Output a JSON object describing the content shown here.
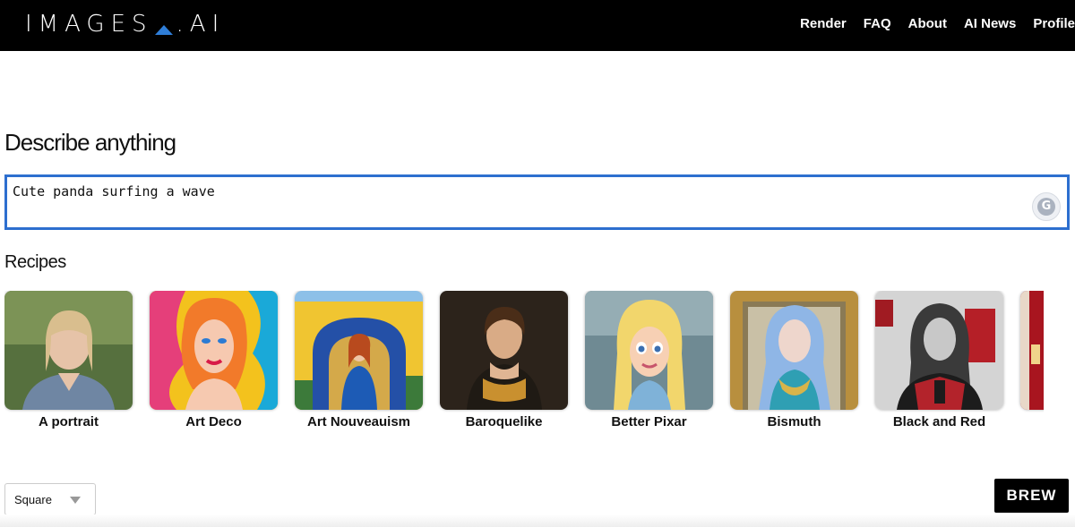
{
  "header": {
    "logo_left": "IMAGES",
    "logo_right": ".AI",
    "nav": [
      "Render",
      "FAQ",
      "About",
      "AI News",
      "Profile"
    ]
  },
  "main": {
    "heading": "Describe anything",
    "prompt_value": "Cute panda surfing a wave",
    "recipes_title": "Recipes",
    "recipes": [
      {
        "name": "A portrait"
      },
      {
        "name": "Art Deco"
      },
      {
        "name": "Art Nouveauism"
      },
      {
        "name": "Baroquelike"
      },
      {
        "name": "Better Pixar"
      },
      {
        "name": "Bismuth"
      },
      {
        "name": "Black and Red"
      }
    ],
    "aspect_select": "Square",
    "brew_label": "BREW"
  },
  "colors": {
    "header_bg": "#000000",
    "accent_blue": "#2d6fcf",
    "brew_bg": "#000000"
  },
  "icons": [
    "grammarly-icon",
    "logo-triangle-icon",
    "dropdown-caret-icon"
  ]
}
